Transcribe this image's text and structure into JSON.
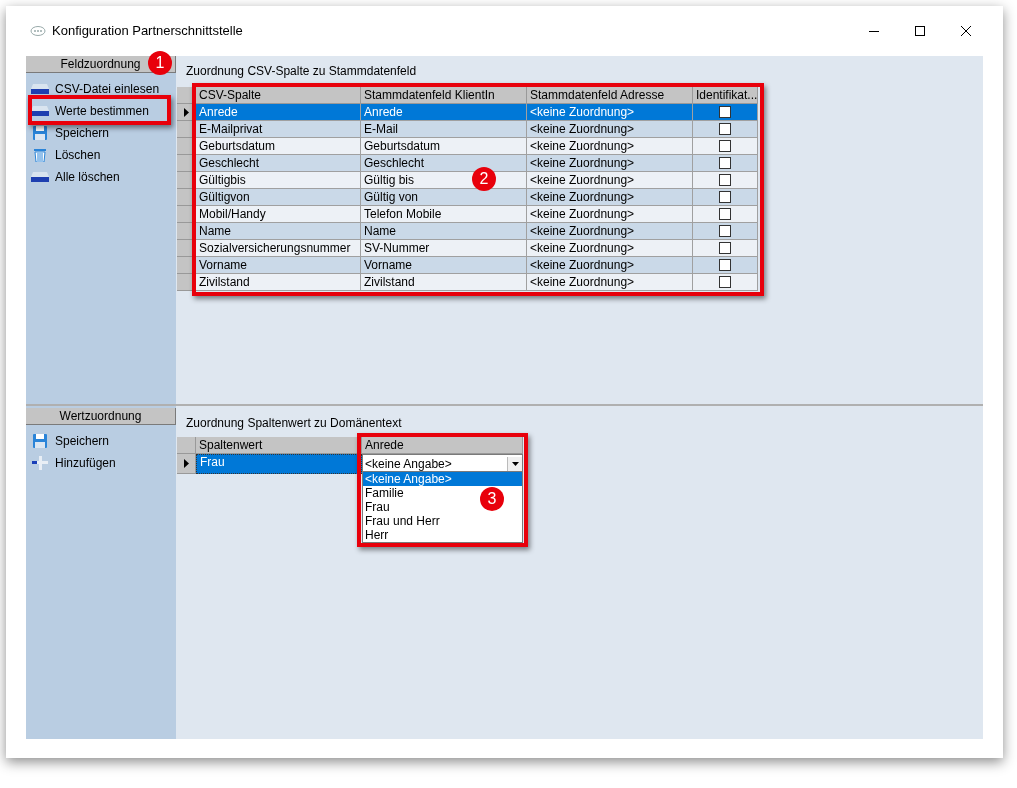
{
  "window": {
    "title": "Konfiguration Partnerschnittstelle"
  },
  "field_panel": {
    "header": "Feldzuordnung",
    "items": [
      {
        "label": "CSV-Datei einlesen",
        "kind": "tray",
        "highlighted": false
      },
      {
        "label": "Werte bestimmen",
        "kind": "tray",
        "highlighted": true
      },
      {
        "label": "Speichern",
        "kind": "disk",
        "highlighted": false
      },
      {
        "label": "Löschen",
        "kind": "trash",
        "highlighted": false
      },
      {
        "label": "Alle löschen",
        "kind": "tray",
        "highlighted": false
      }
    ]
  },
  "field_mapping": {
    "title": "Zuordnung CSV-Spalte zu Stammdatenfeld",
    "highlighted": true,
    "columns": [
      "CSV-Spalte",
      "Stammdatenfeld KlientIn",
      "Stammdatenfeld Adresse",
      "Identifikat..."
    ],
    "rows": [
      {
        "cells": [
          "Anrede",
          "Anrede",
          "<keine Zuordnung>"
        ],
        "checked": false,
        "selected": true
      },
      {
        "cells": [
          "E-Mailprivat",
          "E-Mail",
          "<keine Zuordnung>"
        ],
        "checked": false,
        "selected": false
      },
      {
        "cells": [
          "Geburtsdatum",
          "Geburtsdatum",
          "<keine Zuordnung>"
        ],
        "checked": false,
        "selected": false
      },
      {
        "cells": [
          "Geschlecht",
          "Geschlecht",
          "<keine Zuordnung>"
        ],
        "checked": false,
        "selected": false
      },
      {
        "cells": [
          "Gültigbis",
          "Gültig bis",
          "<keine Zuordnung>"
        ],
        "checked": false,
        "selected": false
      },
      {
        "cells": [
          "Gültigvon",
          "Gültig von",
          "<keine Zuordnung>"
        ],
        "checked": false,
        "selected": false
      },
      {
        "cells": [
          "Mobil/Handy",
          "Telefon Mobile",
          "<keine Zuordnung>"
        ],
        "checked": false,
        "selected": false
      },
      {
        "cells": [
          "Name",
          "Name",
          "<keine Zuordnung>"
        ],
        "checked": false,
        "selected": false
      },
      {
        "cells": [
          "Sozialversicherungsnummer",
          "SV-Nummer",
          "<keine Zuordnung>"
        ],
        "checked": false,
        "selected": false
      },
      {
        "cells": [
          "Vorname",
          "Vorname",
          "<keine Zuordnung>"
        ],
        "checked": false,
        "selected": false
      },
      {
        "cells": [
          "Zivilstand",
          "Zivilstand",
          "<keine Zuordnung>"
        ],
        "checked": false,
        "selected": false
      }
    ]
  },
  "value_panel": {
    "header": "Wertzuordnung",
    "items": [
      {
        "label": "Speichern",
        "kind": "disk"
      },
      {
        "label": "Hinzufügen",
        "kind": "plus"
      }
    ]
  },
  "value_mapping": {
    "title": "Zuordnung Spaltenwert zu Domänentext",
    "highlighted": true,
    "columns": [
      "Spaltenwert",
      "Anrede"
    ],
    "rows": [
      {
        "value": "Frau",
        "choice": "<keine Angabe>",
        "selected": true
      }
    ],
    "dropdown": {
      "expanded": true,
      "options": [
        {
          "label": "<keine Angabe>",
          "selected": true
        },
        {
          "label": "Familie",
          "selected": false
        },
        {
          "label": "Frau",
          "selected": false
        },
        {
          "label": "Frau und Herr",
          "selected": false
        },
        {
          "label": "Herr",
          "selected": false
        }
      ]
    }
  },
  "annotations": [
    {
      "label": "1"
    },
    {
      "label": "2"
    },
    {
      "label": "3"
    }
  ]
}
